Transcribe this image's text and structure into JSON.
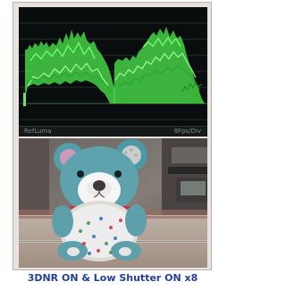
{
  "caption": "3DNR ON & Low Shutter ON x8",
  "waveform_status": {
    "left_label": "RefLuma",
    "right_label": "8Fps/Div"
  },
  "colors": {
    "caption_text": "#213f9f",
    "waveform_trace": "#59ff59",
    "waveform_background": "#0b0f0e"
  },
  "icons": [
    "waveform-display",
    "teddy-bear-photo"
  ]
}
